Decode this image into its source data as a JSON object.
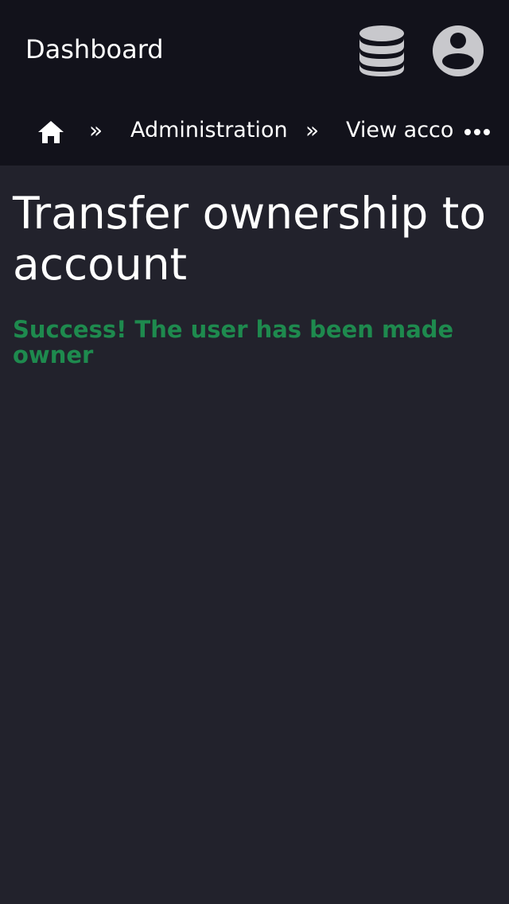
{
  "header": {
    "brand": "Dashboard",
    "icons": [
      "database-icon",
      "user-account-icon"
    ]
  },
  "breadcrumb": {
    "home_icon": "home-icon",
    "separator": "»",
    "items": [
      "Administration",
      "View account"
    ],
    "overflow_icon": "more-horizontal-icon"
  },
  "main": {
    "title": "Transfer ownership to account",
    "success_message": "Success! The user has been made owner"
  },
  "colors": {
    "header_bg": "#12121b",
    "page_bg": "#22222c",
    "text": "#ffffff",
    "icon": "#c8c8cc",
    "success": "#1e8a4e"
  }
}
